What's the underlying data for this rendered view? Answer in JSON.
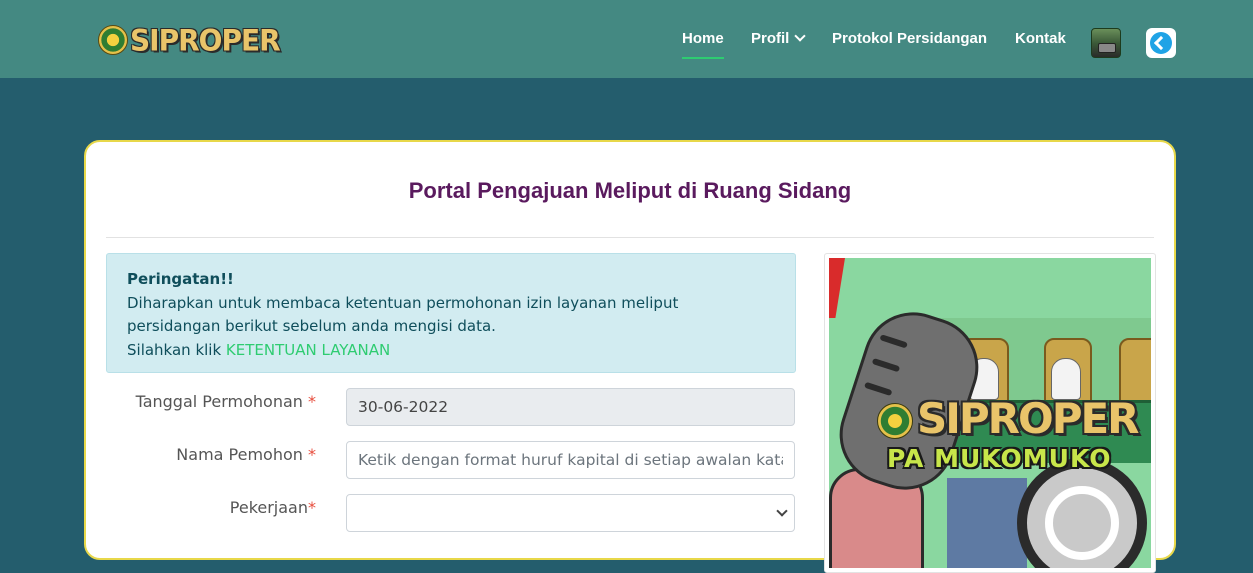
{
  "brand": {
    "logo_text": "SIPROPER"
  },
  "nav": {
    "items": [
      {
        "label": "Home",
        "active": true
      },
      {
        "label": "Profil",
        "has_dropdown": true
      },
      {
        "label": "Protokol Persidangan"
      },
      {
        "label": "Kontak"
      }
    ],
    "icons": [
      "app-icon",
      "logout-icon"
    ],
    "accent": "#2ecc71"
  },
  "card": {
    "title": "Portal Pengajuan Meliput di Ruang Sidang"
  },
  "alert": {
    "title": "Peringatan!!",
    "line1": "Diharapkan untuk membaca ketentuan permohonan izin layanan meliput persidangan berikut sebelum anda mengisi data.",
    "line2_prefix": "Silahkan klik ",
    "link": "KETENTUAN LAYANAN"
  },
  "form": {
    "tanggal": {
      "label": "Tanggal Permohonan ",
      "required_mark": "*",
      "value": "30-06-2022"
    },
    "nama": {
      "label": "Nama Pemohon ",
      "required_mark": "*",
      "placeholder": "Ketik dengan format huruf kapital di setiap awalan kata"
    },
    "pekerjaan": {
      "label": "Pekerjaan",
      "required_mark": "*",
      "value": ""
    }
  },
  "poster": {
    "logo_text": "SIPROPER",
    "subtitle": "PA MUKOMUKO"
  },
  "colors": {
    "navbar": "#448982",
    "page_bg": "#245d6d",
    "title": "#5a1a5e",
    "card_border": "#e8d84a"
  }
}
